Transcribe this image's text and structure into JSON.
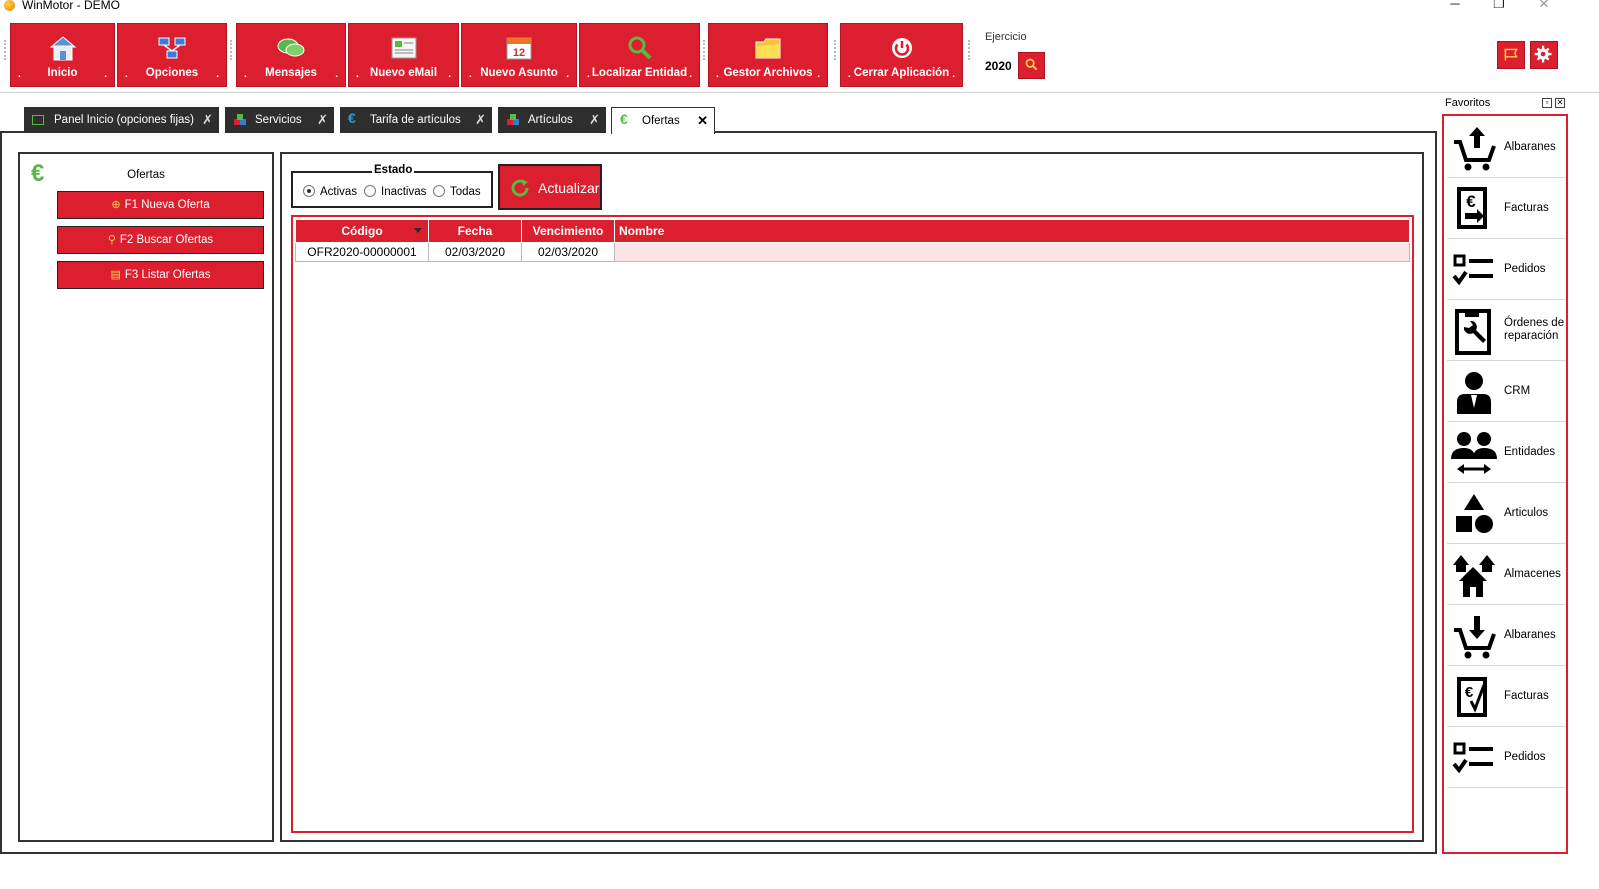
{
  "window": {
    "title": "WinMotor - DEMO",
    "controls": {
      "minimize": "─",
      "maximize": "❐",
      "close": "✕"
    }
  },
  "toolbar": {
    "buttons": [
      {
        "label": "Inicio",
        "icon": "home-icon"
      },
      {
        "label": "Opciones",
        "icon": "network-icon"
      },
      {
        "label": "Mensajes",
        "icon": "chat-bubbles-icon"
      },
      {
        "label": "Nuevo eMail",
        "icon": "email-icon"
      },
      {
        "label": "Nuevo Asunto",
        "icon": "calendar-icon"
      },
      {
        "label": "Localizar Entidad",
        "icon": "search-icon"
      },
      {
        "label": "Gestor Archivos",
        "icon": "folder-icon"
      },
      {
        "label": "Cerrar Aplicación",
        "icon": "power-icon"
      }
    ],
    "dot": ".",
    "ejercicio": {
      "label": "Ejercicio",
      "value": "2020"
    }
  },
  "tabs": [
    {
      "label": "Panel Inicio (opciones fijas)",
      "icon": "panel-icon",
      "close": "✗"
    },
    {
      "label": "Servicios",
      "icon": "blocks-icon",
      "close": "✗"
    },
    {
      "label": "Tarifa de artículos",
      "icon": "euro-icon",
      "close": "✗"
    },
    {
      "label": "Artículos",
      "icon": "blocks-icon",
      "close": "✗"
    },
    {
      "label": "Ofertas",
      "icon": "euro-icon",
      "close": "✕",
      "active": true
    }
  ],
  "left_panel": {
    "title": "Ofertas",
    "euro_symbol": "€",
    "actions": [
      {
        "label": "F1 Nueva Oferta",
        "icon": "add-icon"
      },
      {
        "label": "F2 Buscar Ofertas",
        "icon": "search-icon"
      },
      {
        "label": "F3 Listar Ofertas",
        "icon": "list-icon"
      }
    ]
  },
  "estado": {
    "legend": "Estado",
    "options": [
      {
        "label": "Activas",
        "checked": true
      },
      {
        "label": "Inactivas",
        "checked": false
      },
      {
        "label": "Todas",
        "checked": false
      }
    ]
  },
  "refresh_button": {
    "label": "Actualizar"
  },
  "grid": {
    "columns": [
      "Código",
      "Fecha",
      "Vencimiento",
      "Nombre"
    ],
    "rows": [
      [
        "OFR2020-00000001",
        "02/03/2020",
        "02/03/2020",
        ""
      ]
    ]
  },
  "favoritos": {
    "title": "Favoritos",
    "items": [
      {
        "label": "Albaranes",
        "icon": "cart-upload-icon"
      },
      {
        "label": "Facturas",
        "icon": "invoice-in-icon"
      },
      {
        "label": "Pedidos",
        "icon": "checklist-icon"
      },
      {
        "label": "Órdenes de reparación",
        "icon": "wrench-document-icon"
      },
      {
        "label": "CRM",
        "icon": "person-icon"
      },
      {
        "label": "Entidades",
        "icon": "people-exchange-icon"
      },
      {
        "label": "Articulos",
        "icon": "shapes-icon"
      },
      {
        "label": "Almacenes",
        "icon": "warehouses-icon"
      },
      {
        "label": "Albaranes",
        "icon": "cart-download-icon"
      },
      {
        "label": "Facturas",
        "icon": "invoice-check-icon"
      },
      {
        "label": "Pedidos",
        "icon": "checklist-icon"
      }
    ]
  },
  "colors": {
    "accent": "#dc1f2e",
    "euro_green": "#5ab946",
    "tab_dark": "#2e2e2e"
  }
}
